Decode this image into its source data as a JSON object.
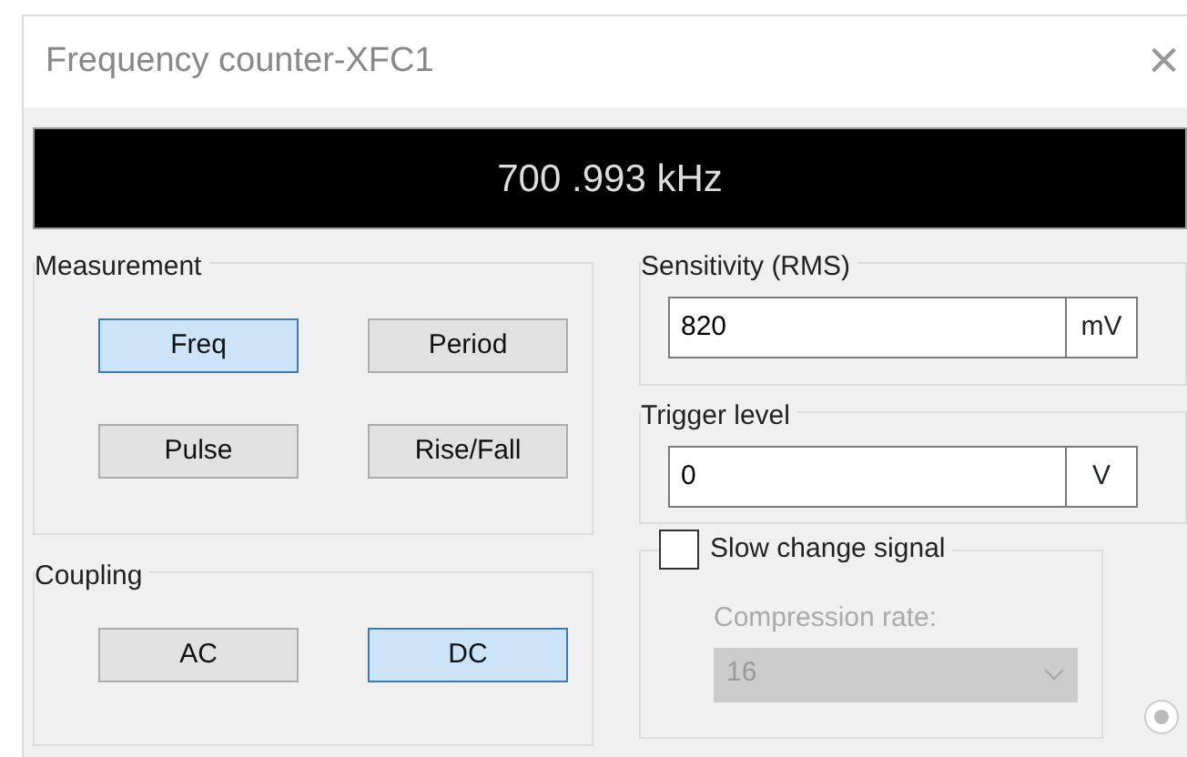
{
  "window": {
    "title": "Frequency counter-XFC1",
    "close": "×"
  },
  "display": {
    "reading": "700 .993 kHz"
  },
  "measurement": {
    "label": "Measurement",
    "buttons": [
      {
        "label": "Freq",
        "selected": true
      },
      {
        "label": "Period",
        "selected": false
      },
      {
        "label": "Pulse",
        "selected": false
      },
      {
        "label": "Rise/Fall",
        "selected": false
      }
    ]
  },
  "coupling": {
    "label": "Coupling",
    "buttons": [
      {
        "label": "AC",
        "selected": false
      },
      {
        "label": "DC",
        "selected": true
      }
    ]
  },
  "sensitivity": {
    "label": "Sensitivity (RMS)",
    "value": "820",
    "unit": "mV"
  },
  "trigger": {
    "label": "Trigger level",
    "value": "0",
    "unit": "V"
  },
  "slow_change": {
    "label": "Slow change signal",
    "checked": false,
    "compression_label": "Compression rate:",
    "compression_value": "16",
    "disabled": true
  }
}
